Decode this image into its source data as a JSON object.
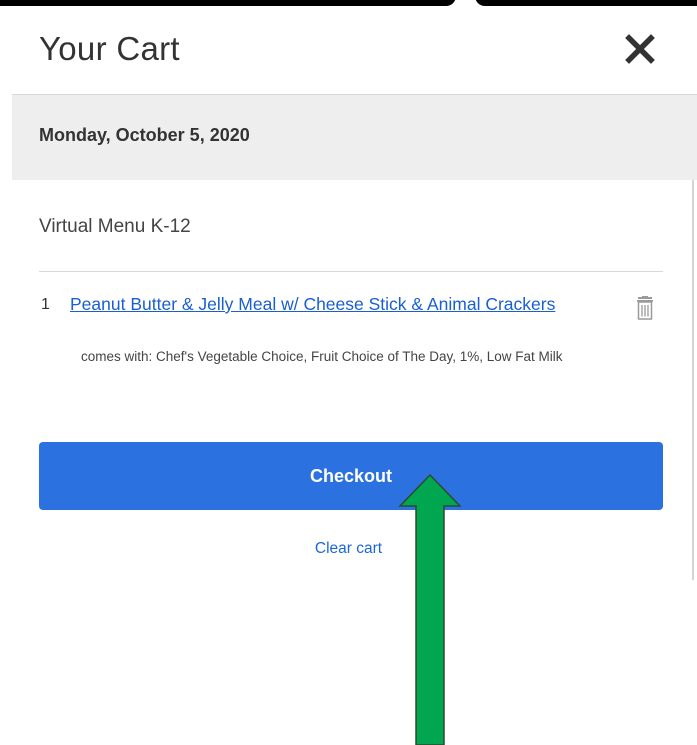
{
  "cart": {
    "title": "Your Cart",
    "close_label": "close",
    "date": "Monday, October 5, 2020",
    "menu_name": "Virtual Menu K-12",
    "items": [
      {
        "quantity": "1",
        "name": "Peanut Butter & Jelly Meal w/ Cheese Stick & Animal Crackers",
        "description": "comes with: Chef's Vegetable Choice, Fruit Choice of The Day, 1%, Low Fat Milk",
        "delete_icon": "trash-icon"
      }
    ],
    "checkout_label": "Checkout",
    "clear_label": "Clear cart"
  },
  "annotation": {
    "arrow_color": "#00a650",
    "arrow_outline": "#2d4a2d",
    "arrow_icon": "arrow-up-icon"
  },
  "colors": {
    "accent": "#2b71e0",
    "link": "#1a5fd0",
    "date_bar": "#eeeeee"
  }
}
